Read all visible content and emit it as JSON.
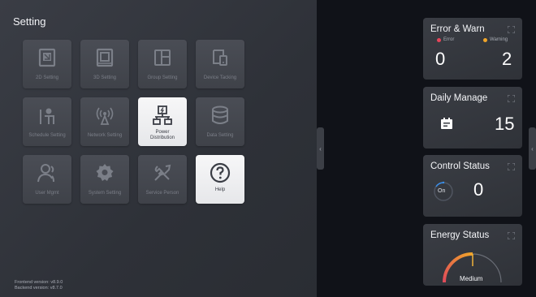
{
  "title": "Setting",
  "tiles": [
    {
      "label": "2D Setting",
      "icon": "2d-setting-icon"
    },
    {
      "label": "3D Setting",
      "icon": "3d-setting-icon"
    },
    {
      "label": "Group Setting",
      "icon": "group-setting-icon"
    },
    {
      "label": "Device Tacking",
      "icon": "device-tracking-icon"
    },
    {
      "label": "Schedule Setting",
      "icon": "schedule-setting-icon"
    },
    {
      "label": "Network Setting",
      "icon": "network-setting-icon"
    },
    {
      "label": "Power\nDistribution",
      "icon": "power-distribution-icon",
      "active": true
    },
    {
      "label": "Data Setting",
      "icon": "data-setting-icon"
    },
    {
      "label": "User Mgmt",
      "icon": "user-mgmt-icon"
    },
    {
      "label": "System Setting",
      "icon": "system-setting-icon"
    },
    {
      "label": "Service Person",
      "icon": "service-person-icon"
    },
    {
      "label": "Help",
      "icon": "help-icon",
      "active": true
    }
  ],
  "version": {
    "frontend": "Frontend version: v8.9.0",
    "backend": "Backend version: v8.7.0"
  },
  "cards": {
    "error_warn": {
      "title": "Error & Warn",
      "error_label": "Error",
      "warning_label": "Warning",
      "error_count": "0",
      "warning_count": "2",
      "error_color": "#e8455a",
      "warning_color": "#f0a52a"
    },
    "daily_manage": {
      "title": "Daily Manage",
      "count": "15"
    },
    "control_status": {
      "title": "Control Status",
      "toggle_label": "On",
      "count": "0"
    },
    "energy_status": {
      "title": "Energy Status",
      "level_label": "Medium",
      "level": 0.5
    }
  }
}
